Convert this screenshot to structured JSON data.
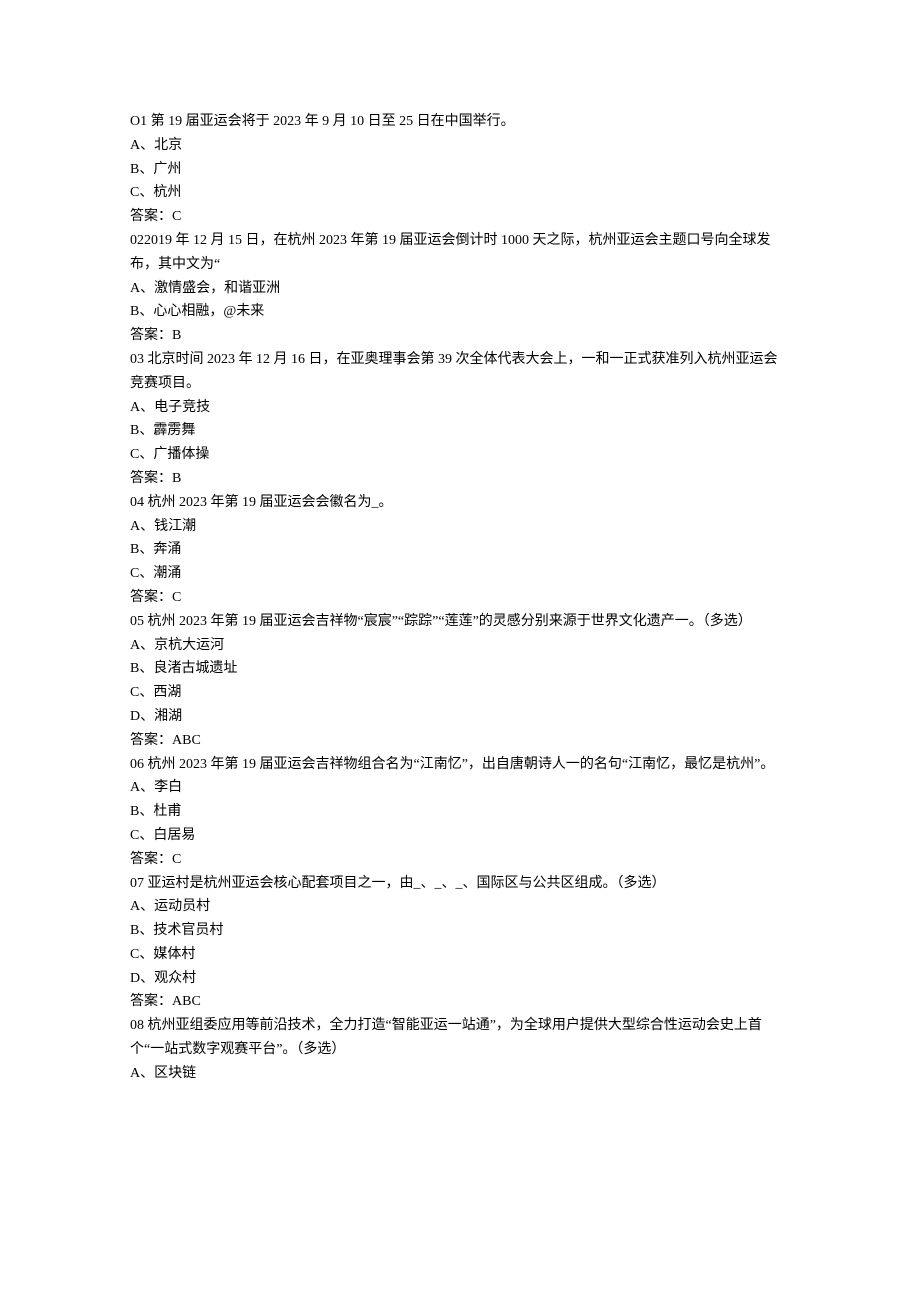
{
  "questions": [
    {
      "stem": "O1 第 19 届亚运会将于 2023 年 9 月 10 日至 25 日在中国举行。",
      "options": [
        "A、北京",
        "B、广州",
        "C、杭州"
      ],
      "answer": "答案：C"
    },
    {
      "stem": "022019 年 12 月 15 日，在杭州 2023 年第 19 届亚运会倒计时 1000 天之际，杭州亚运会主题口号向全球发布，其中文为“",
      "options": [
        "A、激情盛会，和谐亚洲",
        "B、心心相融，@未来"
      ],
      "answer": "答案：B"
    },
    {
      "stem": "03 北京时间 2023 年 12 月 16 日，在亚奥理事会第 39 次全体代表大会上，一和一正式获准列入杭州亚运会竞赛项目。",
      "options": [
        "A、电子竞技",
        "B、霹雳舞",
        "C、广播体操"
      ],
      "answer": "答案：B"
    },
    {
      "stem": "04 杭州 2023 年第 19 届亚运会会徽名为_。",
      "options": [
        "A、钱江潮",
        "B、奔涌",
        "C、潮涌"
      ],
      "answer": "答案：C"
    },
    {
      "stem": "05 杭州 2023 年第 19 届亚运会吉祥物“宸宸”“踪踪”“莲莲”的灵感分别来源于世界文化遗产一。（多选）",
      "options": [
        "A、京杭大运河",
        "B、良渚古城遗址",
        "C、西湖",
        "D、湘湖"
      ],
      "answer": "答案：ABC"
    },
    {
      "stem": "06 杭州 2023 年第 19 届亚运会吉祥物组合名为“江南忆”，出自唐朝诗人一的名句“江南忆，最忆是杭州”。",
      "options": [
        "A、李白",
        "B、杜甫",
        "C、白居易"
      ],
      "answer": "答案：C"
    },
    {
      "stem": "07 亚运村是杭州亚运会核心配套项目之一，由_、_、_、国际区与公共区组成。（多选）",
      "options": [
        "A、运动员村",
        "B、技术官员村",
        "C、媒体村",
        "D、观众村"
      ],
      "answer": "答案：ABC"
    },
    {
      "stem": "08 杭州亚组委应用等前沿技术，全力打造“智能亚运一站通”，为全球用户提供大型综合性运动会史上首个“一站式数字观赛平台”。（多选）",
      "options": [
        "A、区块链"
      ],
      "answer": ""
    }
  ]
}
